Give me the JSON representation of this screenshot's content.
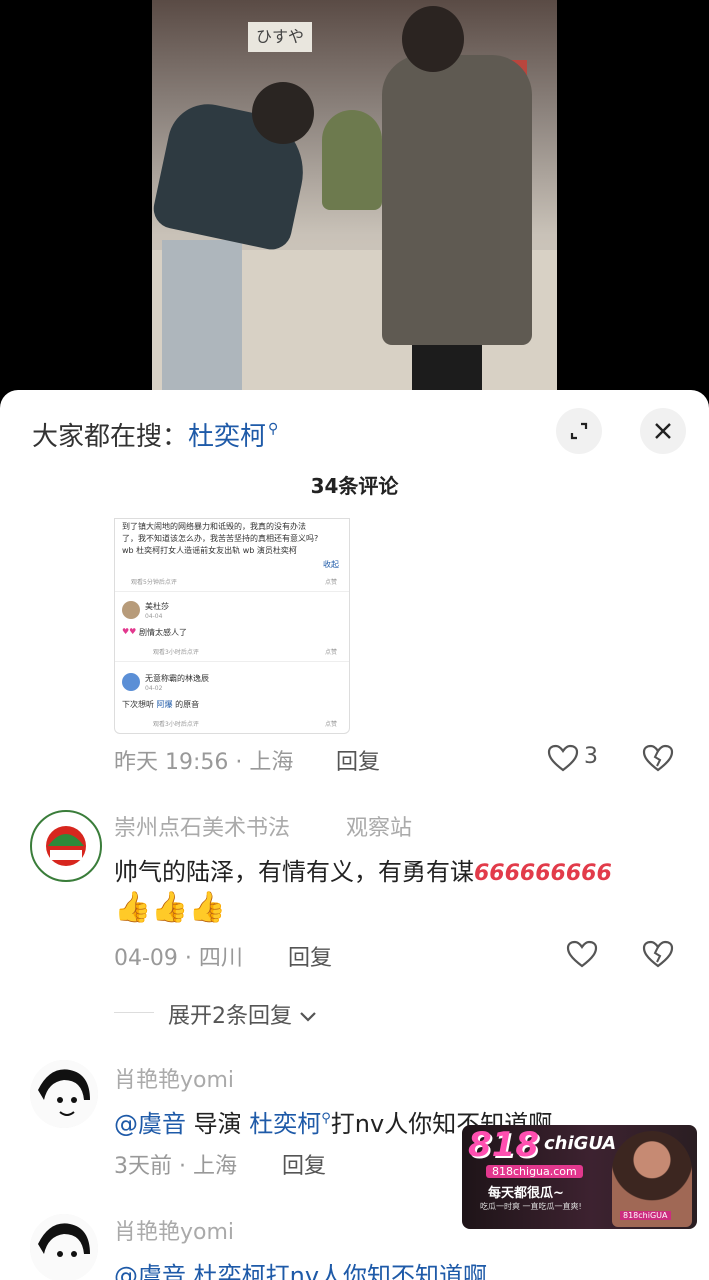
{
  "video": {
    "sign_text": "ひすや"
  },
  "sheet": {
    "search_prefix": "大家都在搜：",
    "search_keyword": "杜奕柯",
    "comment_count": "34条评论"
  },
  "embed": {
    "lines": [
      "到了镇大闹地的网络暴力和诋毁的，我真的没有办法",
      "了，我不知道该怎么办，我苦苦坚持的真相还有意义吗?",
      "wb 杜奕柯打女人造谣前女友出轨 wb 演员杜奕柯"
    ],
    "collapse": "收起",
    "like": "点赞",
    "c1_time": "观看5分钟后点评",
    "c2_name": "美杜莎",
    "c2_date": "04-04",
    "c2_text": "剧情太感人了",
    "c2_time": "观看3小时后点评",
    "c3_name": "无意称霸的林逸辰",
    "c3_date": "04-02",
    "c3_text_pre": "下次想听",
    "c3_mention": "阿爆",
    "c3_text_post": "的原音",
    "c3_time": "观看3小时后点评"
  },
  "comment0": {
    "time": "昨天 19:56",
    "location": "上海",
    "reply": "回复",
    "likes": "3"
  },
  "comment1": {
    "name": "崇州点石美术书法",
    "tag": "观察站",
    "text": "帅气的陆泽，有情有义，有勇有谋",
    "emoji_text": "666666666",
    "thumbs": "👍👍👍",
    "time": "04-09",
    "location": "四川",
    "reply": "回复",
    "expand": "展开2条回复",
    "avatar_text": "崇州点石"
  },
  "comment2": {
    "name": "肖艳艳yomi",
    "mention1": "@虞音",
    "mid": " 导演 ",
    "mention2": "杜奕柯",
    "text_post": "打nv人你知不知道啊",
    "time": "3天前",
    "location": "上海",
    "reply": "回复"
  },
  "comment3": {
    "name": "肖艳艳yomi",
    "text_partial": "@虞音 杜奕柯打nv人你知不知道啊"
  },
  "ad": {
    "logo": "818",
    "logo_sub": "chiGUA",
    "domain": "818chigua.com",
    "slogan": "每天都很瓜~",
    "tag": "吃瓜一时爽 一直吃瓜一直爽!",
    "bottom": "818chiGUA",
    "corner": "818chiGUA"
  },
  "colors": {
    "link": "#1e5aa8",
    "muted": "#999999",
    "ad_pink": "#ff4fb0"
  }
}
